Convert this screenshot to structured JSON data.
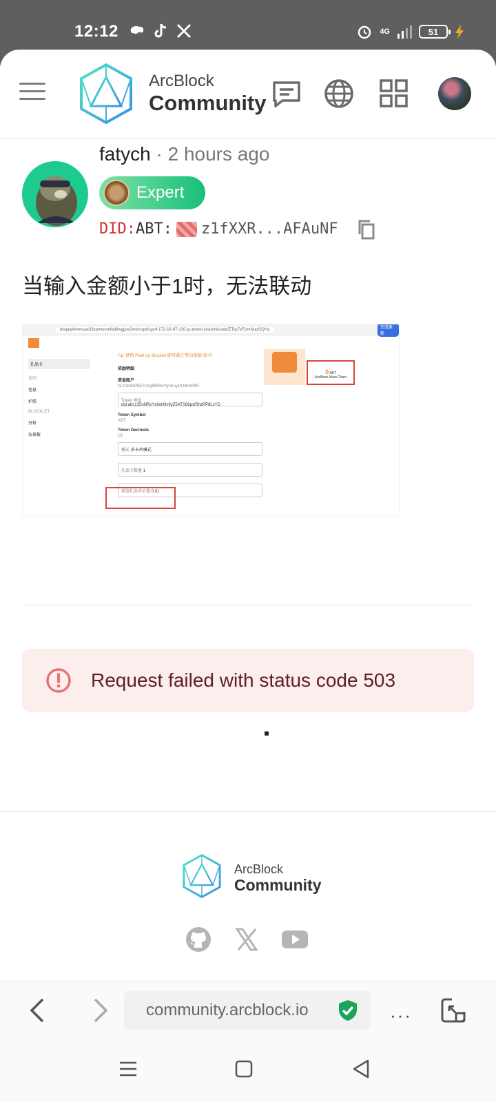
{
  "status_bar": {
    "time": "12:12",
    "network": "4G",
    "battery": "51"
  },
  "header": {
    "logo_line1": "ArcBlock",
    "logo_line2": "Community"
  },
  "post": {
    "author": "fatych",
    "separator": " · ",
    "time_ago": "2 hours ago",
    "badge": "Expert",
    "did_prefix": "DID:",
    "did_type": "ABT:",
    "did_value": "z1fXXR...AFAuNF",
    "body": "当输入金额小于1时，无法联动"
  },
  "screenshot": {
    "url": "bbqaql4rwmsax33xpmwomfdd6wgjpw2mdvcqs6cgc4-172-16-97-130.ip.abtnet.io/admin/add/ZToy7eFpmNupGQHq",
    "button": "完成更新",
    "sidebar": [
      "礼品卡",
      "访问",
      "信息",
      "护照",
      "BLOCKLET",
      "分析",
      "仪表板"
    ],
    "tip": "Tip: 使用 Pixel Up Blocklet 即可通过\"积分奖励\"发卡!",
    "section_title": "奖励明细",
    "account_label": "资金账户",
    "account_value": "z1Y1KdzPBZ7cXg9MRwYjmKuy1tUBrzkt9R",
    "token_address_label": "Token 地址",
    "token_address": "did:abt:z35nNRvYx8oHiIx9yZ5ATS88psfShzPP8LxYD",
    "token_symbol_label": "Token Symbol",
    "token_symbol": "ABT",
    "token_decimals_label": "Token Decimals",
    "token_decimals": "18",
    "mode_label": "模式",
    "mode_value": "多卡片模式",
    "count_label": "礼品卡数量",
    "count_value": "1",
    "amount_label": "单张礼品卡价值",
    "amount_value": "0.01",
    "balance": "0",
    "balance_unit": "ABT",
    "chain": "ArcBlock Main Chain"
  },
  "error": {
    "message": "Request failed with status code 503"
  },
  "footer": {
    "logo_line1": "ArcBlock",
    "logo_line2": "Community"
  },
  "browser": {
    "url": "community.arcblock.io",
    "more": "···"
  },
  "colors": {
    "badge": "#18c07a",
    "error_bg": "#fdeeee",
    "error_icon": "#e57373",
    "shield": "#1aa35a"
  }
}
